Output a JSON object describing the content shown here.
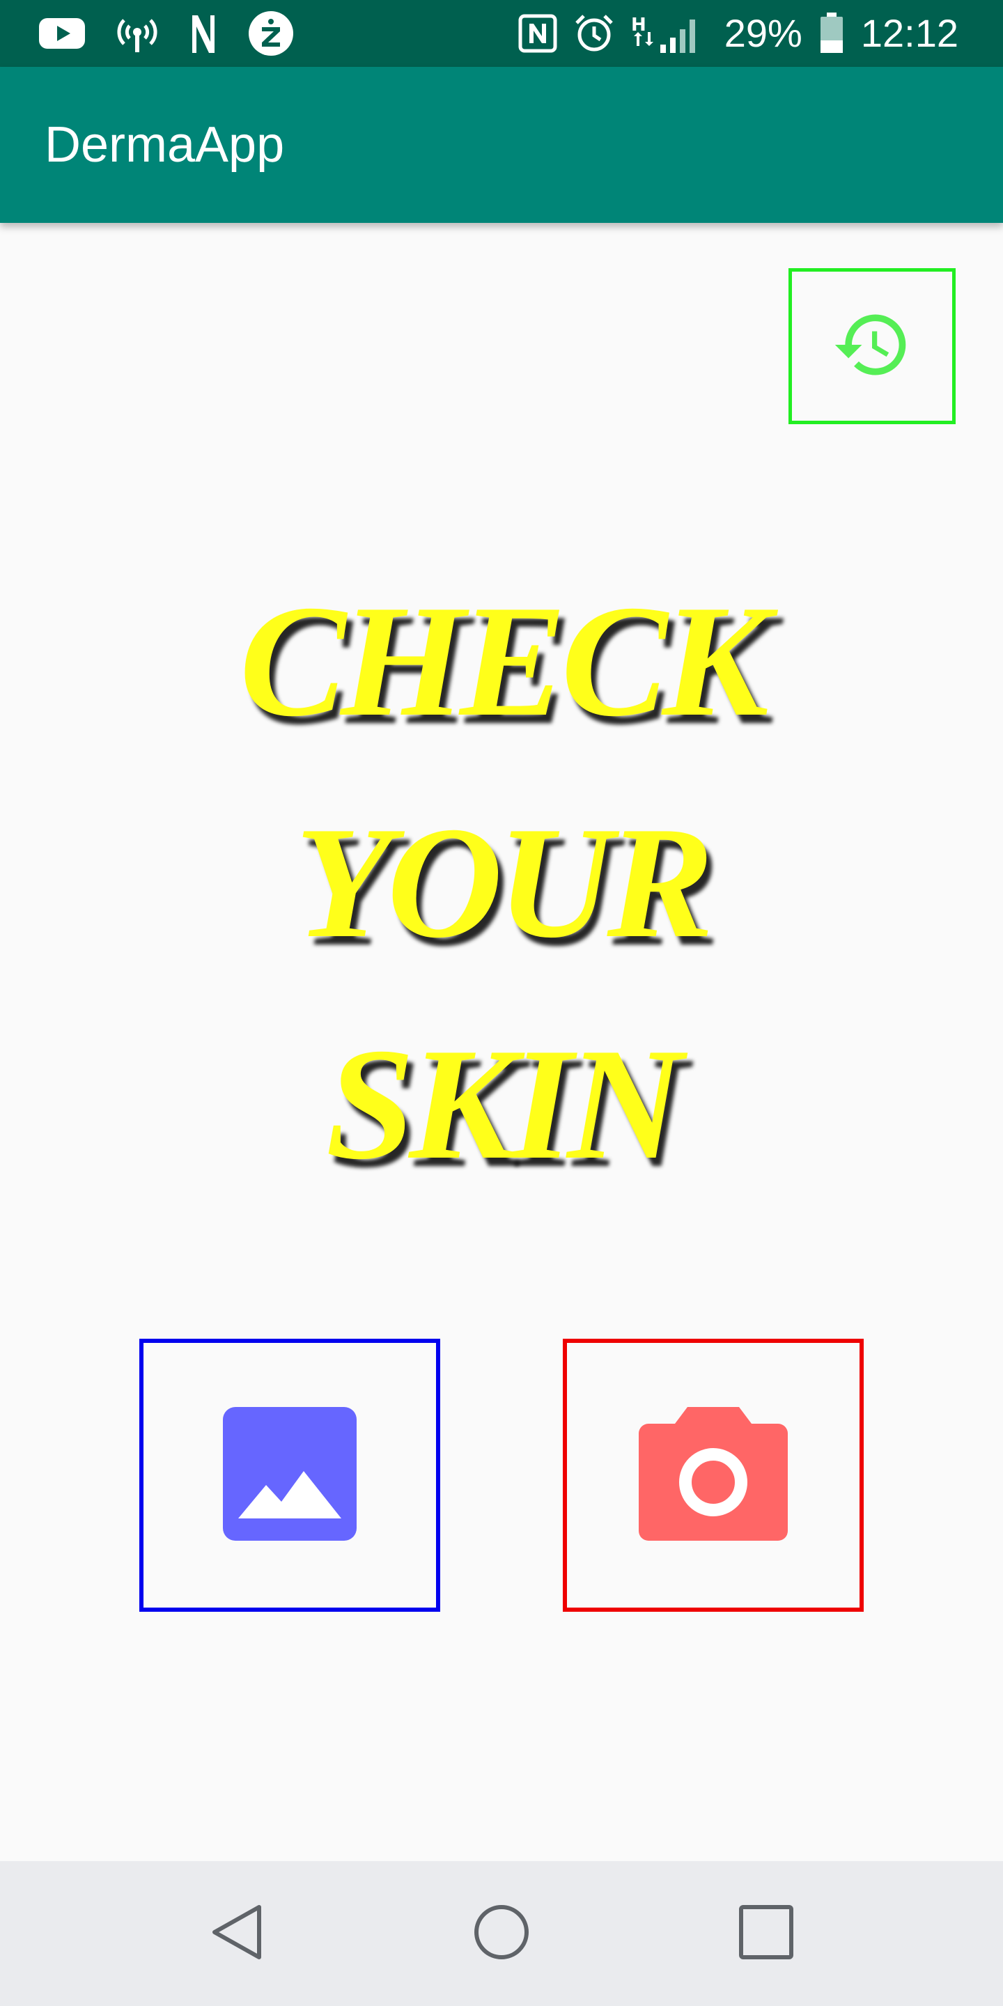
{
  "status_bar": {
    "battery": "29%",
    "time": "12:12",
    "left_icons": [
      "youtube-icon",
      "hotspot-icon",
      "n-app-icon",
      "z-app-icon"
    ],
    "right_icons": [
      "nfc-icon",
      "alarm-icon",
      "signal-icon",
      "battery-icon"
    ]
  },
  "app_bar": {
    "title": "DermaApp"
  },
  "hero": {
    "lines": [
      "CHECK",
      "YOUR",
      "SKIN"
    ]
  },
  "buttons": {
    "history": "history-icon",
    "gallery": "gallery-icon",
    "camera": "camera-icon"
  },
  "nav": [
    "back-icon",
    "home-icon",
    "recents-icon"
  ],
  "colors": {
    "status_bar": "#00604f",
    "app_bar": "#008577",
    "hero_text": "#ffff1a",
    "history_border": "#22ee22",
    "history_icon": "#55ee55",
    "gallery_border": "#0000ee",
    "gallery_icon": "#6666ff",
    "camera_border": "#ee0000",
    "camera_icon": "#ff6666",
    "nav_bar": "#eaebee",
    "nav_icon": "#5f6368"
  }
}
